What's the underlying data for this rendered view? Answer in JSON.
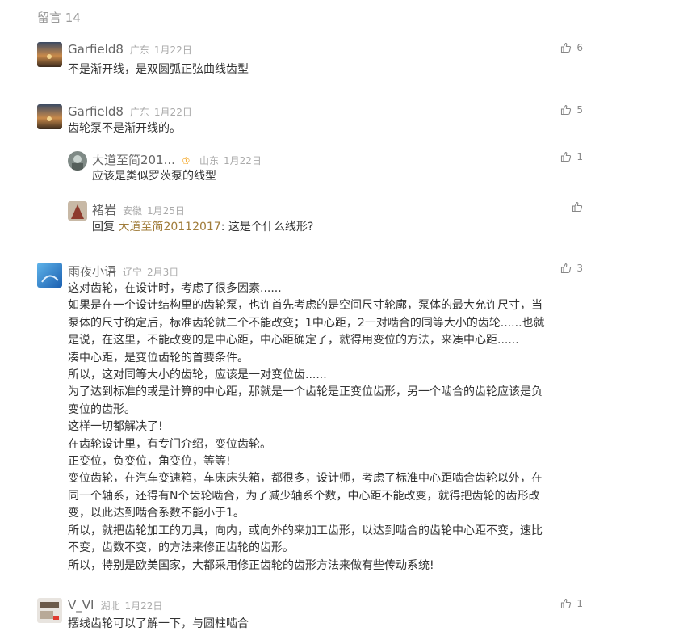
{
  "header": {
    "title": "留言 14"
  },
  "colors": {
    "quote": "#a07c3a",
    "badge": "#f5a623"
  },
  "comments": [
    {
      "name": "Garfield8",
      "location": "广东",
      "date": "1月22日",
      "likes": "6",
      "text": "不是渐开线，是双圆弧正弦曲线齿型"
    },
    {
      "name": "Garfield8",
      "location": "广东",
      "date": "1月22日",
      "likes": "5",
      "text": "齿轮泵不是渐开线的。",
      "replies": [
        {
          "name": "大道至简201...",
          "location": "山东",
          "date": "1月22日",
          "likes": "1",
          "text": "应该是类似罗茨泵的线型"
        },
        {
          "name": "褚岩",
          "location": "安徽",
          "date": "1月25日",
          "likes": "",
          "reply_prefix": "回复",
          "reply_to": "大道至简20112017",
          "text": ": 这是个什么线形?"
        }
      ]
    },
    {
      "name": "雨夜小语",
      "location": "辽宁",
      "date": "2月3日",
      "likes": "3",
      "lines": [
        "这对齿轮，在设计时，考虑了很多因素......",
        "如果是在一个设计结构里的齿轮泵，也许首先考虑的是空间尺寸轮廓，泵体的最大允许尺寸，当",
        "泵体的尺寸确定后，标准齿轮就二个不能改变；1中心距，2一对啮合的同等大小的齿轮......也就",
        "是说，在这里，不能改变的是中心距，中心距确定了，就得用变位的方法，来凑中心距......",
        "凑中心距，是变位齿轮的首要条件。",
        "所以，这对同等大小的齿轮，应该是一对变位齿......",
        "为了达到标准的或是计算的中心距，那就是一个齿轮是正变位齿形，另一个啮合的齿轮应该是负",
        "变位的齿形。",
        "这样一切都解决了!",
        "在齿轮设计里，有专门介绍，变位齿轮。",
        "正变位，负变位，角变位，等等!",
        "变位齿轮，在汽车变速箱，车床床头箱，都很多，设计师，考虑了标准中心距啮合齿轮以外，在",
        "同一个轴系，还得有N个齿轮啮合，为了减少轴系个数，中心距不能改变，就得把齿轮的齿形改",
        "变，以此达到啮合系数不能小于1。",
        "所以，就把齿轮加工的刀具，向内，或向外的来加工齿形，以达到啮合的齿轮中心距不变，速比",
        "不变，齿数不变，的方法来修正齿轮的齿形。",
        "所以，特别是欧美国家，大都采用修正齿轮的齿形方法来做有些传动系统!"
      ]
    },
    {
      "name": "V_VI",
      "location": "湖北",
      "date": "1月22日",
      "likes": "1",
      "text": "摆线齿轮可以了解一下，与圆柱啮合"
    }
  ]
}
